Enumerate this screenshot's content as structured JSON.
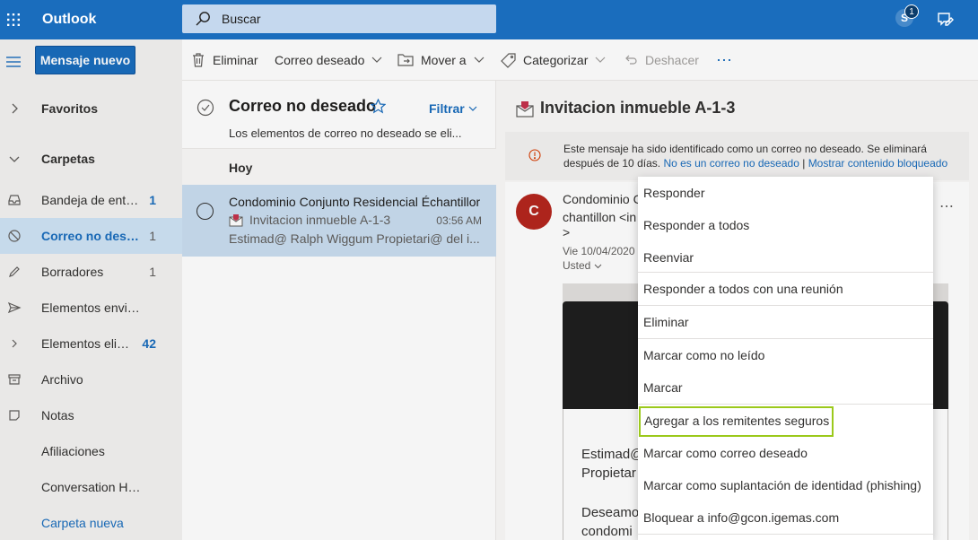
{
  "app": {
    "brand": "Outlook",
    "accent": "#1a6dbd",
    "icons": [
      "waffle-icon",
      "search-icon",
      "skype-icon",
      "feedback-icon"
    ]
  },
  "topbar": {
    "search_placeholder": "Buscar",
    "skype_letter": "S",
    "skype_badge": "1"
  },
  "leftnav": {
    "new_message": "Mensaje nuevo",
    "items": [
      {
        "label": "Favoritos",
        "count": "",
        "icon": "chevron-right-icon"
      },
      {
        "label": "Carpetas",
        "count": "",
        "icon": "chevron-down-icon"
      },
      {
        "label": "Bandeja de entr…",
        "count": "1",
        "icon": "inbox-icon"
      },
      {
        "label": "Correo no dese…",
        "count": "1",
        "icon": "junk-icon"
      },
      {
        "label": "Borradores",
        "count": "1",
        "icon": "pencil-icon"
      },
      {
        "label": "Elementos enviad…",
        "count": "",
        "icon": "send-icon"
      },
      {
        "label": "Elementos eli…",
        "count": "42",
        "icon": "chevron-right-icon"
      },
      {
        "label": "Archivo",
        "count": "",
        "icon": "archive-icon"
      },
      {
        "label": "Notas",
        "count": "",
        "icon": "note-icon"
      },
      {
        "label": "Afiliaciones",
        "count": "",
        "icon": ""
      },
      {
        "label": "Conversation Hist…",
        "count": "",
        "icon": ""
      },
      {
        "label": "Carpeta nueva",
        "count": "",
        "icon": ""
      }
    ]
  },
  "toolbar": {
    "delete": "Eliminar",
    "junk": "Correo deseado",
    "move": "Mover a",
    "categorize": "Categorizar",
    "undo": "Deshacer",
    "more": "⋯"
  },
  "messagelist": {
    "title": "Correo no deseado",
    "filter": "Filtrar",
    "description": "Los elementos de correo no deseado se eli...",
    "group": "Hoy",
    "item": {
      "from": "Condominio Conjunto Residencial Échantillor",
      "subject": "Invitacion inmueble A-1-3",
      "time": "03:56 AM",
      "preview": "Estimad@ Ralph Wiggum Propietari@ del i..."
    }
  },
  "reading": {
    "subject": "Invitacion inmueble A-1-3",
    "warning_text": "Este mensaje ha sido identificado como un correo no deseado. Se eliminará después de 10 días.",
    "not_junk_link": "No es un correo no deseado",
    "divider": "|",
    "show_blocked_link": "Mostrar contenido bloqueado",
    "avatar_letter": "C",
    "sender_line1": "Condominio C",
    "sender_line2": "chantillon <in",
    "sender_line3": ">",
    "date": "Vie 10/04/2020",
    "to": "Usted",
    "more": "⋯",
    "body_line1": "Estimad@",
    "body_line2": "Propietar",
    "body_line3": "Deseamo",
    "body_line4": "condomi"
  },
  "context_menu": {
    "items": [
      "Responder",
      "Responder a todos",
      "Reenviar",
      "Responder a todos con una reunión",
      "Eliminar",
      "Marcar como no leído",
      "Marcar",
      "Agregar a los remitentes seguros",
      "Marcar como correo deseado",
      "Marcar como suplantación de identidad (phishing)",
      "Bloquear a info@gcon.igemas.com"
    ],
    "highlight_color": "#9bc91b"
  }
}
